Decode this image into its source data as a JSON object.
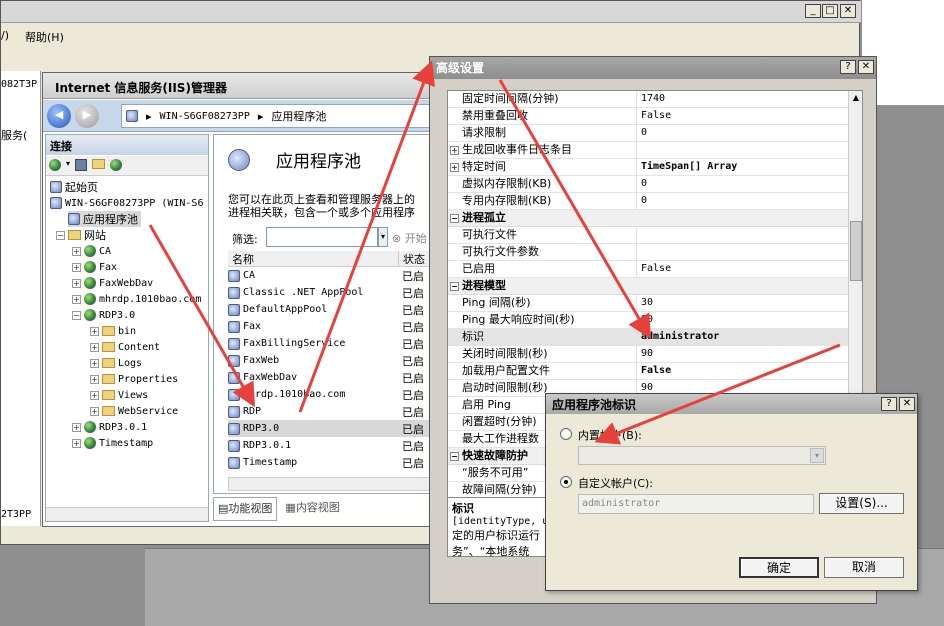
{
  "background_window": {
    "menu_left": "/)",
    "menu_help": "帮助(H)",
    "left_label_1": "082T3P",
    "left_label_2": "服务(",
    "left_label_3": "2T3PP"
  },
  "iis": {
    "title": "Internet 信息服务(IIS)管理器",
    "breadcrumb": [
      "WIN-S6GF08273PP",
      "应用程序池"
    ],
    "connections_title": "连接",
    "tree": {
      "start_page": "起始页",
      "server": "WIN-S6GF08273PP (WIN-S6",
      "app_pools": "应用程序池",
      "sites": "网站",
      "site_items": [
        "CA",
        "Fax",
        "FaxWebDav",
        "mhrdp.1010bao.com",
        "RDP3.0"
      ],
      "rdp_children": [
        "bin",
        "Content",
        "Logs",
        "Properties",
        "Views",
        "WebService"
      ],
      "more_sites": [
        "RDP3.0.1",
        "Timestamp"
      ]
    },
    "page_title": "应用程序池",
    "page_desc_1": "您可以在此页上查看和管理服务器上的",
    "page_desc_2": "进程相关联，包含一个或多个应用程序",
    "filter_label": "筛选:",
    "filter_go": "开始",
    "columns": {
      "name": "名称",
      "status": "状态"
    },
    "pools": [
      {
        "name": "CA",
        "status": "已启"
      },
      {
        "name": "Classic .NET AppPool",
        "status": "已启"
      },
      {
        "name": "DefaultAppPool",
        "status": "已启"
      },
      {
        "name": "Fax",
        "status": "已启"
      },
      {
        "name": "FaxBillingService",
        "status": "已启"
      },
      {
        "name": "FaxWeb",
        "status": "已启"
      },
      {
        "name": "FaxWebDav",
        "status": "已启"
      },
      {
        "name": "mhrdp.1010bao.com",
        "status": "已启"
      },
      {
        "name": "RDP",
        "status": "已启"
      },
      {
        "name": "RDP3.0",
        "status": "已启"
      },
      {
        "name": "RDP3.0.1",
        "status": "已启"
      },
      {
        "name": "Timestamp",
        "status": "已启"
      }
    ],
    "view_features": "功能视图",
    "view_content": "内容视图"
  },
  "advanced": {
    "title": "高级设置",
    "help_btn": "?",
    "close_btn": "✕",
    "rows": [
      {
        "type": "prop",
        "key": "固定时间间隔(分钟)",
        "value": "1740"
      },
      {
        "type": "prop",
        "key": "禁用重叠回收",
        "value": "False"
      },
      {
        "type": "prop",
        "key": "请求限制",
        "value": "0"
      },
      {
        "type": "prop",
        "key": "生成回收事件日志条目",
        "value": "",
        "expander": "+"
      },
      {
        "type": "prop",
        "key": "特定时间",
        "value": "TimeSpan[] Array",
        "bold": true,
        "expander": "+"
      },
      {
        "type": "prop",
        "key": "虚拟内存限制(KB)",
        "value": "0"
      },
      {
        "type": "prop",
        "key": "专用内存限制(KB)",
        "value": "0"
      },
      {
        "type": "cat",
        "key": "进程孤立"
      },
      {
        "type": "prop",
        "key": "可执行文件",
        "value": ""
      },
      {
        "type": "prop",
        "key": "可执行文件参数",
        "value": ""
      },
      {
        "type": "prop",
        "key": "已启用",
        "value": "False"
      },
      {
        "type": "cat",
        "key": "进程模型"
      },
      {
        "type": "prop",
        "key": "Ping 间隔(秒)",
        "value": "30"
      },
      {
        "type": "prop",
        "key": "Ping 最大响应时间(秒)",
        "value": "90"
      },
      {
        "type": "prop",
        "key": "标识",
        "value": "administrator",
        "bold": true,
        "selected": true
      },
      {
        "type": "prop",
        "key": "关闭时间限制(秒)",
        "value": "90"
      },
      {
        "type": "prop",
        "key": "加载用户配置文件",
        "value": "False",
        "bold": true
      },
      {
        "type": "prop",
        "key": "启动时间限制(秒)",
        "value": "90"
      },
      {
        "type": "prop",
        "key": "启用 Ping",
        "value": ""
      },
      {
        "type": "prop",
        "key": "闲置超时(分钟)",
        "value": ""
      },
      {
        "type": "prop",
        "key": "最大工作进程数",
        "value": ""
      },
      {
        "type": "cat",
        "key": "快速故障防护"
      },
      {
        "type": "prop",
        "key": "“服务不可用”",
        "value": ""
      },
      {
        "type": "prop",
        "key": "故障间隔(分钟)",
        "value": ""
      }
    ],
    "desc_title": "标识",
    "desc_text_1": "[identityType, u",
    "desc_text_2": "定的用户标识运行",
    "desc_text_3": "务”、“本地系统"
  },
  "identity": {
    "title": "应用程序池标识",
    "help_btn": "?",
    "close_btn": "✕",
    "builtin_label": "内置帐户(B):",
    "custom_label": "自定义帐户(C):",
    "custom_value": "administrator",
    "set_button": "设置(S)...",
    "ok_button": "确定",
    "cancel_button": "取消"
  },
  "colors": {
    "arrow": "#e8413b",
    "selection": "#d8d8d8",
    "iis_header": "#c9d7ea"
  }
}
